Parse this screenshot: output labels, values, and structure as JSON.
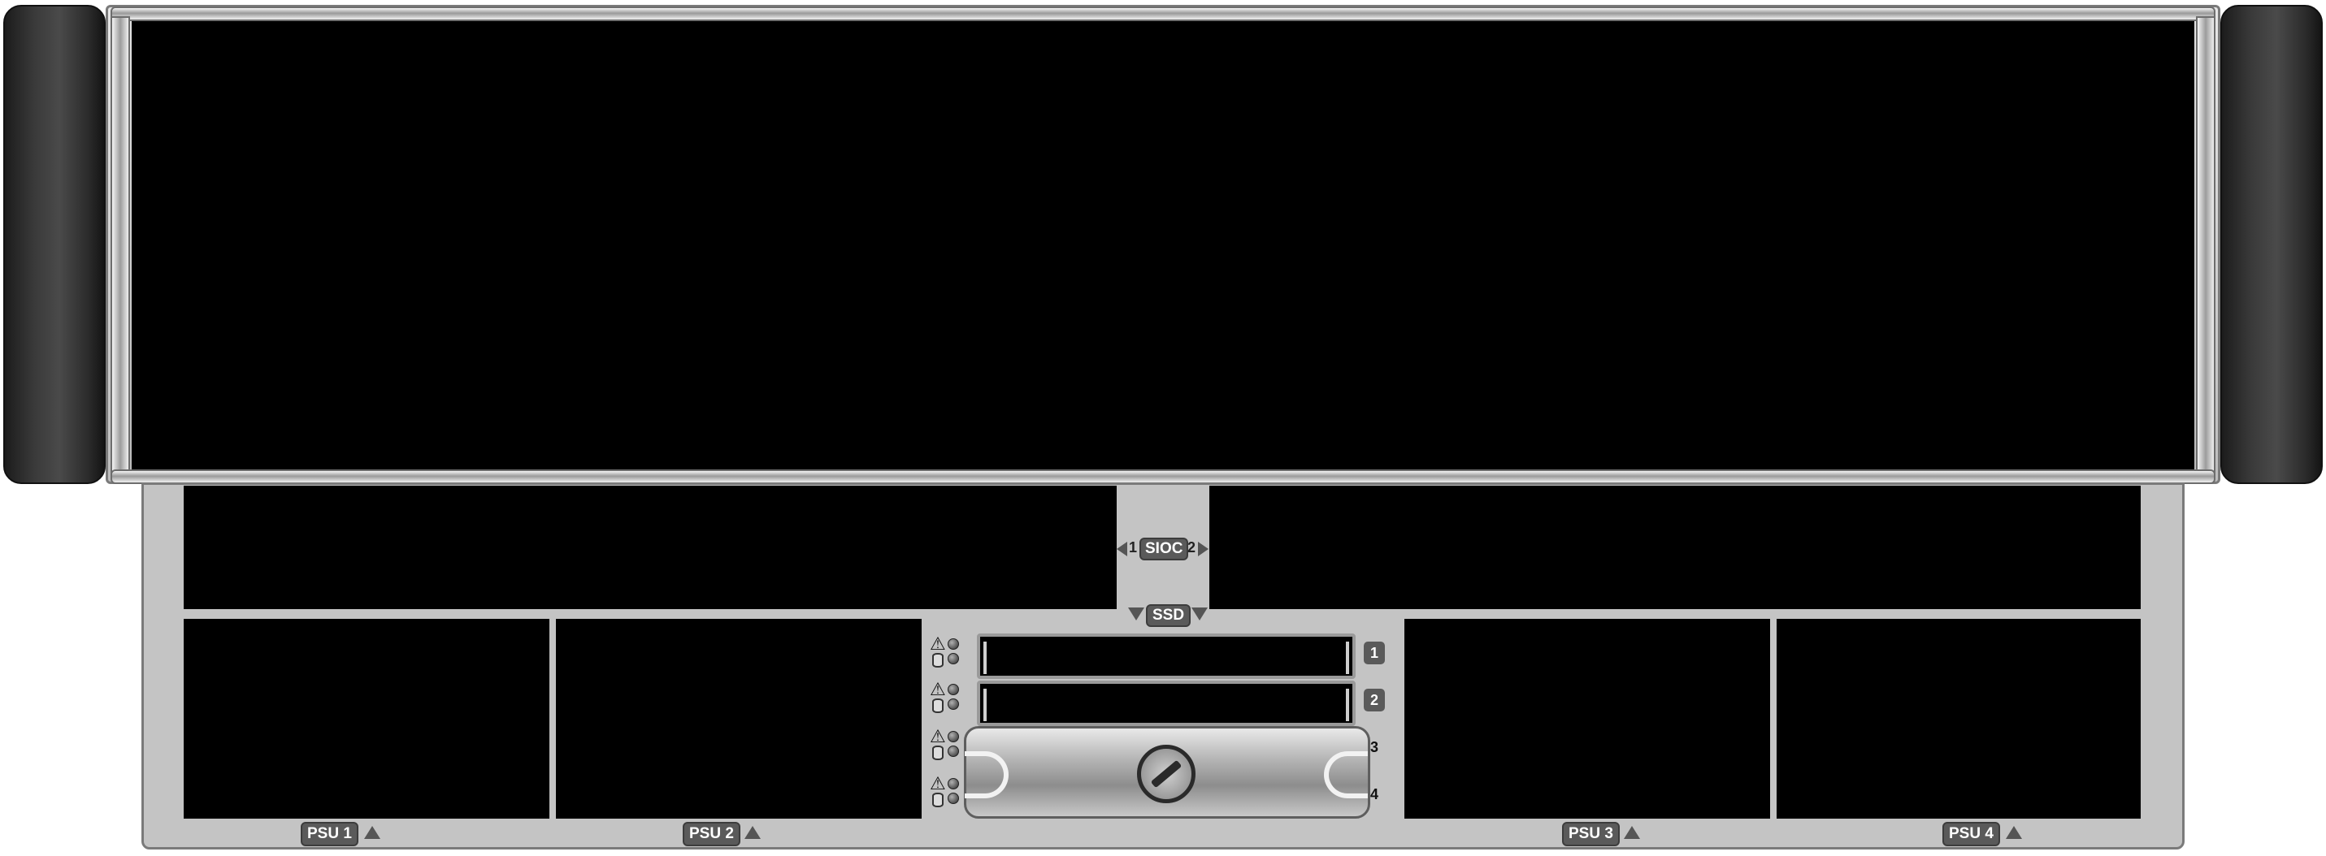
{
  "sioc": {
    "label": "SIOC",
    "left_num": "1",
    "right_num": "2"
  },
  "ssd": {
    "label": "SSD",
    "slots": [
      "1",
      "2",
      "3",
      "4"
    ]
  },
  "psu": [
    "PSU 1",
    "PSU 2",
    "PSU 3",
    "PSU 4"
  ],
  "icons": {
    "warning": "warning-icon",
    "drive": "drive-icon",
    "arrow": "triangle-arrow-icon"
  },
  "colors": {
    "chassis": "#c4c4c4",
    "bay": "#000000",
    "label_bg": "#5a5a5a",
    "ear": "#2f2f2f"
  }
}
